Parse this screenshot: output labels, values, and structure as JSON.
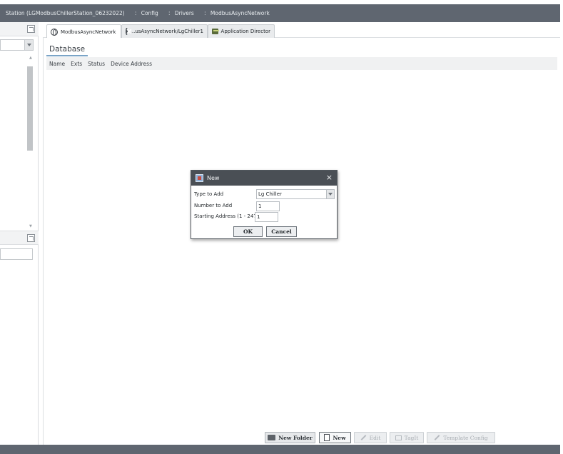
{
  "breadcrumb": {
    "station": "Station (LGModbusChillerStation_06232022)",
    "config": "Config",
    "drivers": "Drivers",
    "network": "ModbusAsyncNetwork",
    "separator": ":"
  },
  "tabs": [
    {
      "label": "ModbusAsyncNetwork",
      "icon": "globe-icon",
      "active": true
    },
    {
      "label": "...usAsyncNetwork/LgChiller1",
      "icon": "error-icon",
      "active": false
    },
    {
      "label": "Application Director",
      "icon": "app-director-icon",
      "active": false
    }
  ],
  "database": {
    "title": "Database",
    "columns": [
      "Name",
      "Exts",
      "Status",
      "Device Address"
    ]
  },
  "dialog": {
    "title": "New",
    "close": "×",
    "type_label": "Type to Add",
    "type_value": "Lg Chiller",
    "number_label": "Number to Add",
    "number_value": "1",
    "address_label": "Starting Address (1 - 247)",
    "address_value": "1",
    "ok": "OK",
    "cancel": "Cancel"
  },
  "buttons": {
    "new_folder": "New Folder",
    "new": "New",
    "edit": "Edit",
    "tagit": "TagIt",
    "template_config": "Template Config"
  }
}
